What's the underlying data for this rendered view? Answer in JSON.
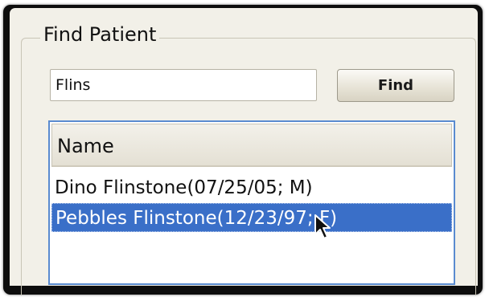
{
  "group_title": "Find Patient",
  "search": {
    "value": "Flins"
  },
  "find_button": {
    "label": "Find"
  },
  "list": {
    "column_header": "Name",
    "rows": [
      {
        "text": "Dino Flinstone(07/25/05; M)",
        "selected": false
      },
      {
        "text": "Pebbles Flinstone(12/23/97; F)",
        "selected": true
      }
    ]
  },
  "colors": {
    "selection": "#3a6fc8",
    "list_border": "#5a8bd0",
    "panel": "#f2f0e8"
  }
}
